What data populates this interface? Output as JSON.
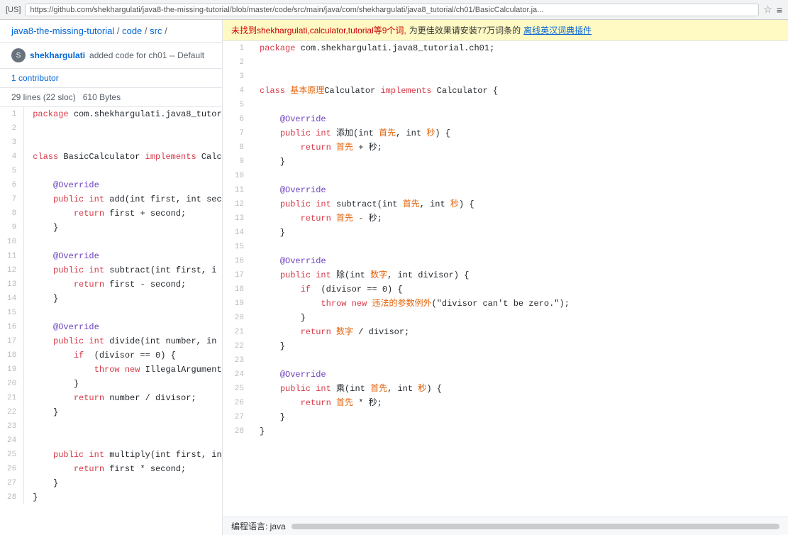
{
  "browser": {
    "locale": "[US]",
    "url": "https://github.com/shekhargulati/java8-the-missing-tutorial/blob/master/code/src/main/java/com/shekhargulati/java8_tutorial/ch01/BasicCalculator.ja...",
    "star_icon": "☆",
    "menu_icon": "≡"
  },
  "breadcrumb": {
    "parts": [
      "java8-the-missing-tutorial",
      "/",
      "code",
      "/",
      "src",
      "/"
    ]
  },
  "commit": {
    "username": "shekhargulati",
    "message": "added code for ch01 -- Default"
  },
  "contributor": {
    "label": "1 contributor"
  },
  "file_stats": {
    "lines": "29 lines (22 sloc)",
    "size": "610 Bytes"
  },
  "left_code": {
    "lines": [
      {
        "num": 1,
        "text": "package com.shekhargulati.java8_tutor"
      },
      {
        "num": 2,
        "text": ""
      },
      {
        "num": 3,
        "text": ""
      },
      {
        "num": 4,
        "text": "class BasicCalculator implements Calc"
      },
      {
        "num": 5,
        "text": ""
      },
      {
        "num": 6,
        "text": "    @Override"
      },
      {
        "num": 7,
        "text": "    public int add(int first, int sec"
      },
      {
        "num": 8,
        "text": "        return first + second;"
      },
      {
        "num": 9,
        "text": "    }"
      },
      {
        "num": 10,
        "text": ""
      },
      {
        "num": 11,
        "text": "    @Override"
      },
      {
        "num": 12,
        "text": "    public int subtract(int first, i"
      },
      {
        "num": 13,
        "text": "        return first - second;"
      },
      {
        "num": 14,
        "text": "    }"
      },
      {
        "num": 15,
        "text": ""
      },
      {
        "num": 16,
        "text": "    @Override"
      },
      {
        "num": 17,
        "text": "    public int divide(int number, in"
      },
      {
        "num": 18,
        "text": "        if (divisor == 0) {"
      },
      {
        "num": 19,
        "text": "            throw new IllegalArgument"
      },
      {
        "num": 20,
        "text": "        }"
      },
      {
        "num": 21,
        "text": "        return number / divisor;"
      },
      {
        "num": 22,
        "text": "    }"
      },
      {
        "num": 23,
        "text": ""
      },
      {
        "num": 24,
        "text": ""
      },
      {
        "num": 25,
        "text": "    public int multiply(int first, int second) {"
      },
      {
        "num": 26,
        "text": "        return first * second;"
      },
      {
        "num": 27,
        "text": "    }"
      },
      {
        "num": 28,
        "text": "}"
      }
    ]
  },
  "translation_banner": {
    "not_found": "未找到shekhargulati,calculator,tutorial等9个词,",
    "suggest": "为更佳效果请安装77万词条的",
    "link_text": "离线英汉词典插件"
  },
  "right_code": {
    "lines": [
      {
        "num": 1,
        "text": "package com.shekhargulati.java8_tutorial.ch01;"
      },
      {
        "num": 2,
        "text": ""
      },
      {
        "num": 3,
        "text": ""
      },
      {
        "num": 4,
        "text": "class 基本原理Calculator implements Calculator {"
      },
      {
        "num": 5,
        "text": ""
      },
      {
        "num": 6,
        "text": "    @Override"
      },
      {
        "num": 7,
        "text": "    public int 添加(int 首先, int 秒) {"
      },
      {
        "num": 8,
        "text": "        return 首先 + 秒;"
      },
      {
        "num": 9,
        "text": "    }"
      },
      {
        "num": 10,
        "text": ""
      },
      {
        "num": 11,
        "text": "    @Override"
      },
      {
        "num": 12,
        "text": "    public int subtract(int 首先, int 秒) {"
      },
      {
        "num": 13,
        "text": "        return 首先 - 秒;"
      },
      {
        "num": 14,
        "text": "    }"
      },
      {
        "num": 15,
        "text": ""
      },
      {
        "num": 16,
        "text": "    @Override"
      },
      {
        "num": 17,
        "text": "    public int 除(int 数字, int divisor) {"
      },
      {
        "num": 18,
        "text": "        if (divisor == 0) {"
      },
      {
        "num": 19,
        "text": "            throw new 违法的参数例外(\"divisor can't be zero.\");"
      },
      {
        "num": 20,
        "text": "        }"
      },
      {
        "num": 21,
        "text": "        return 数字 / divisor;"
      },
      {
        "num": 22,
        "text": "    }"
      },
      {
        "num": 23,
        "text": ""
      },
      {
        "num": 24,
        "text": "    @Override"
      },
      {
        "num": 25,
        "text": "    public int 乘(int 首先, int 秒) {"
      },
      {
        "num": 26,
        "text": "        return 首先 * 秒;"
      },
      {
        "num": 27,
        "text": "    }"
      },
      {
        "num": 28,
        "text": "}"
      }
    ]
  },
  "status_bar": {
    "label": "编程语言: java"
  }
}
